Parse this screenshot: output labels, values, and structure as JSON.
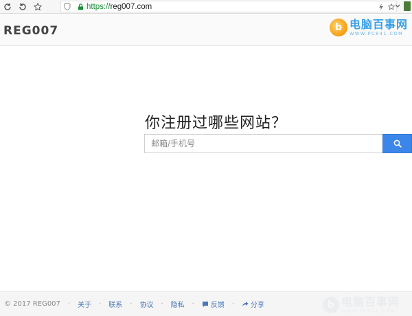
{
  "browser": {
    "url_scheme": "https://",
    "url_host": "reg007.com",
    "icons": [
      "reload-icon",
      "back-icon",
      "star-icon",
      "shield-icon",
      "lock-icon",
      "lightning-icon",
      "bookmark-star-icon",
      "dropdown-icon"
    ]
  },
  "header": {
    "logo": "REG007",
    "watermark_badge": "b",
    "watermark_title": "电脑百事网",
    "watermark_url": "WWW.PC841.COM"
  },
  "search": {
    "title": "你注册过哪些网站？",
    "placeholder": "邮箱/手机号",
    "value": ""
  },
  "footer": {
    "copyright": "© 2017 REG007",
    "sep": "·",
    "links": {
      "about": "关于",
      "contact": "联系",
      "agreement": "协议",
      "privacy": "隐私",
      "feedback": "反馈",
      "share": "分享"
    }
  },
  "colors": {
    "accent": "#3b86e8",
    "link": "#4a78b8",
    "secure": "#1a8e3a"
  }
}
